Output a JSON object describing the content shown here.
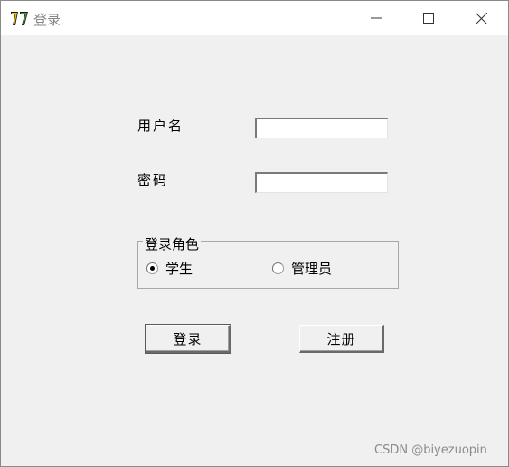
{
  "window": {
    "title": "登录",
    "icon": "app-logo-icon",
    "controls": [
      "minimize-icon",
      "maximize-icon",
      "close-icon"
    ]
  },
  "form": {
    "username_label": "用户名",
    "username_value": "",
    "password_label": "密码",
    "password_value": ""
  },
  "role_group": {
    "legend": "登录角色",
    "options": [
      {
        "label": "学生",
        "selected": true
      },
      {
        "label": "管理员",
        "selected": false
      }
    ]
  },
  "buttons": {
    "login_label": "登录",
    "register_label": "注册"
  },
  "watermark": "CSDN @biyezuopin"
}
